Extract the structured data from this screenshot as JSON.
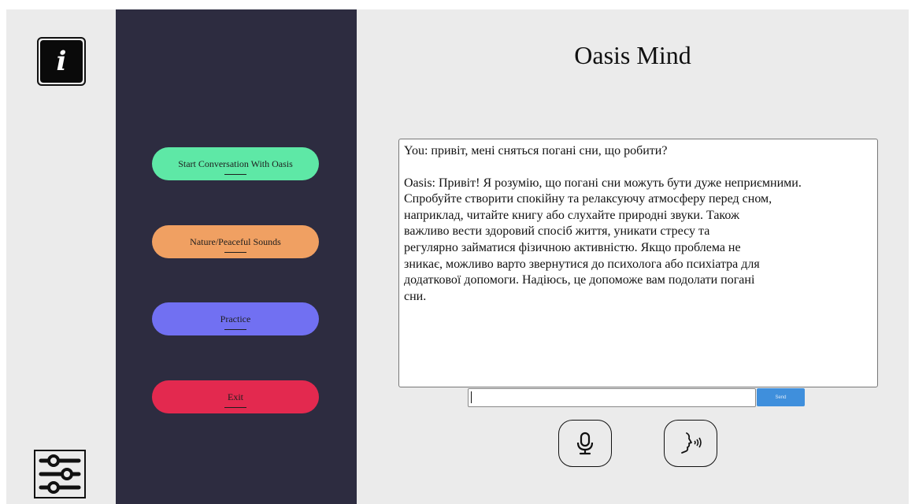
{
  "title": "Oasis Mind",
  "sidebar": {
    "buttons": [
      {
        "label": "Start Conversation With Oasis",
        "color": "#5ee8a6"
      },
      {
        "label": "Nature/Peaceful Sounds",
        "color": "#f0a062"
      },
      {
        "label": "Practice",
        "color": "#7170f2"
      },
      {
        "label": "Exit",
        "color": "#e3294f"
      }
    ],
    "background": "#2d2c40"
  },
  "icons": {
    "info": "info-icon",
    "settings": "sliders-icon",
    "mic": "microphone-icon",
    "speak": "speaking-head-icon"
  },
  "chat": {
    "messages": [
      {
        "text": "You: привіт, мені сняться погані сни, що робити?"
      },
      {
        "text": "Oasis: Привіт! Я розумію, що погані сни можуть бути дуже неприємними.\nСпробуйте створити спокійну та релаксуючу атмосферу перед сном,\nнаприклад, читайте книгу або слухайте природні звуки. Також\nважливо вести здоровий спосіб життя, уникати стресу та\nрегулярно займатися фізичною активністю. Якщо проблема не\nзникає, можливо варто звернутися до психолога або психіатра для\nдодаткової допомоги. Надіюсь, це допоможе вам подолати погані\nсни."
      }
    ]
  },
  "input": {
    "value": "",
    "send_label": "Send",
    "send_color": "#3f8fdc"
  }
}
